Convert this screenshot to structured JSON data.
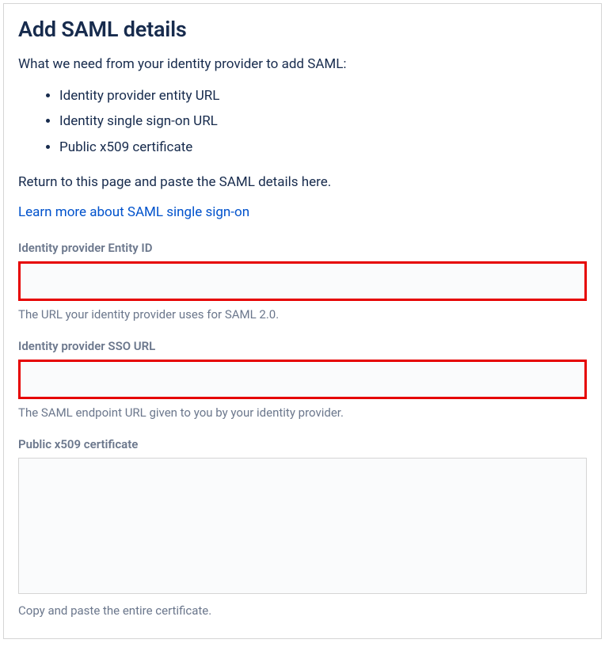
{
  "header": {
    "title": "Add SAML details"
  },
  "intro": {
    "lead": "What we need from your identity provider to add SAML:",
    "requirements": [
      "Identity provider entity URL",
      "Identity single sign-on URL",
      "Public x509 certificate"
    ],
    "return_note": "Return to this page and paste the SAML details here.",
    "learn_more_label": "Learn more about SAML single sign-on"
  },
  "fields": {
    "entity_id": {
      "label": "Identity provider Entity ID",
      "value": "",
      "help": "The URL your identity provider uses for SAML 2.0."
    },
    "sso_url": {
      "label": "Identity provider SSO URL",
      "value": "",
      "help": "The SAML endpoint URL given to you by your identity provider."
    },
    "certificate": {
      "label": "Public x509 certificate",
      "value": "",
      "help": "Copy and paste the entire certificate."
    }
  }
}
